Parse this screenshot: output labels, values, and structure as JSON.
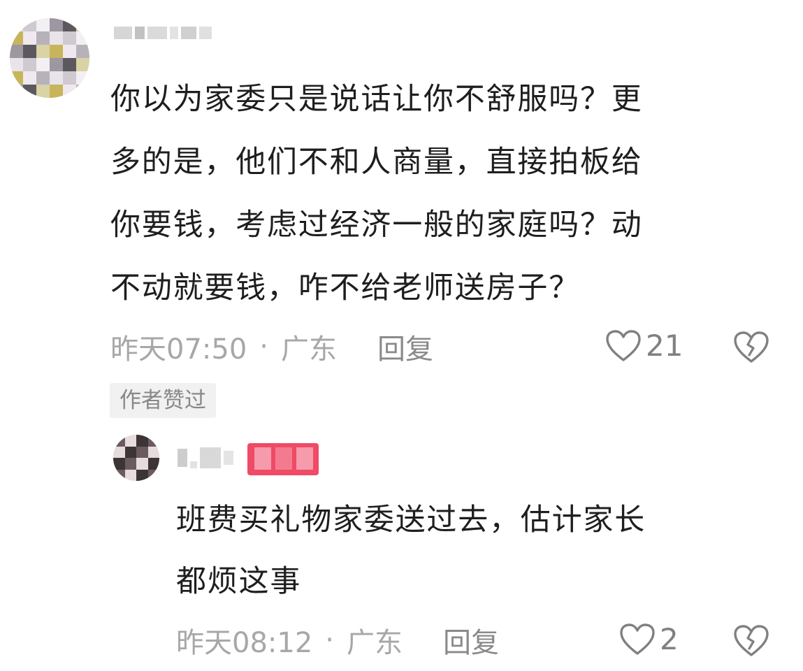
{
  "comment": {
    "username": "",
    "text": "你以为家委只是说话让你不舒服吗？更\n多的是，他们不和人商量，直接拍板给\n你要钱，考虑过经济一般的家庭吗？动\n不动就要钱，咋不给老师送房子？",
    "time": "昨天07:50",
    "separator": "·",
    "location": "广东",
    "reply_label": "回复",
    "likes": "21",
    "author_liked_tag": "作者赞过",
    "icons": {
      "like": "heart-outline-icon",
      "dislike": "broken-heart-icon"
    }
  },
  "reply": {
    "username": "",
    "badge": "",
    "text": "班费买礼物家委送过去，估计家长\n都烦这事",
    "time": "昨天08:12",
    "separator": "·",
    "location": "广东",
    "reply_label": "回复",
    "likes": "2",
    "icons": {
      "like": "heart-outline-icon",
      "dislike": "broken-heart-icon"
    }
  },
  "colors": {
    "text": "#1e1e1e",
    "meta": "#a7a7a7",
    "icon": "#808080",
    "author_badge": "#ef4a66",
    "chip_bg": "#f1f1f1"
  }
}
